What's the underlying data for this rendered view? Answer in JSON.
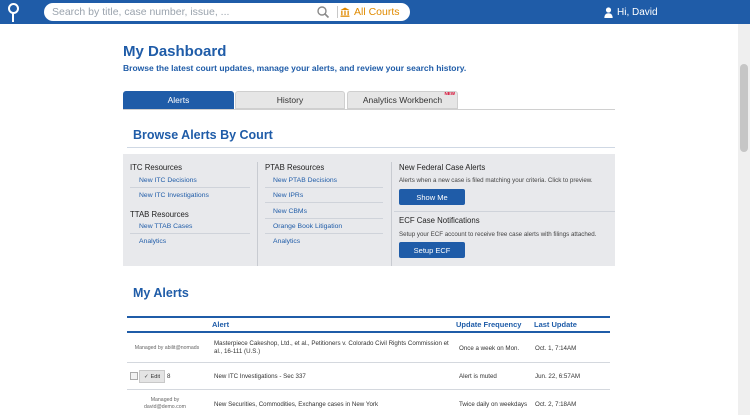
{
  "topbar": {
    "search_placeholder": "Search by title, case number, issue, ...",
    "court_filter_label": "All Courts",
    "user_greeting": "Hi, David"
  },
  "dashboard": {
    "title": "My Dashboard",
    "subtitle": "Browse the latest court updates, manage your alerts, and review your search history."
  },
  "tabs": [
    {
      "label": "Alerts",
      "active": true
    },
    {
      "label": "History",
      "active": false
    },
    {
      "label": "Analytics Workbench",
      "active": false,
      "badge": "NEW"
    }
  ],
  "browse": {
    "title": "Browse Alerts By Court",
    "itc": {
      "heading": "ITC Resources",
      "links": [
        "New ITC Decisions",
        "New ITC Investigations"
      ]
    },
    "ttab": {
      "heading": "TTAB Resources",
      "links": [
        "New TTAB Cases",
        "Analytics"
      ]
    },
    "ptab": {
      "heading": "PTAB Resources",
      "links": [
        "New PTAB Decisions",
        "New IPRs",
        "New CBMs",
        "Orange Book Litigation",
        "Analytics"
      ]
    },
    "federal": {
      "heading": "New Federal Case Alerts",
      "description": "Alerts when a new case is filed matching your criteria. Click to preview.",
      "button": "Show Me"
    },
    "ecf": {
      "heading": "ECF Case Notifications",
      "description": "Setup your ECF account to receive free case alerts with filings attached.",
      "button": "Setup ECF"
    }
  },
  "alerts": {
    "title": "My Alerts",
    "columns": [
      "Alert",
      "Update Frequency",
      "Last Update"
    ],
    "rows": [
      {
        "manager": "Managed by abilit@nomads",
        "alert": "Masterpiece Cakeshop, Ltd., et al., Petitioners v. Colorado Civil Rights Commission et al., 16-111 (U.S.)",
        "frequency": "Once a week on Mon.",
        "last_update": "Oct. 1, 7:14AM"
      },
      {
        "edit_label": "Edit",
        "count": "8",
        "alert": "New ITC Investigations - Sec 337",
        "frequency": "Alert is muted",
        "last_update": "Jun. 22, 6:57AM"
      },
      {
        "manager": "Managed by david@demo.com",
        "alert": "New Securities, Commodities, Exchange cases in New York",
        "frequency": "Twice daily on weekdays",
        "last_update": "Oct. 2, 7:18AM"
      }
    ]
  },
  "colors": {
    "brand": "#1f5ca8",
    "accent": "#e08a00"
  }
}
